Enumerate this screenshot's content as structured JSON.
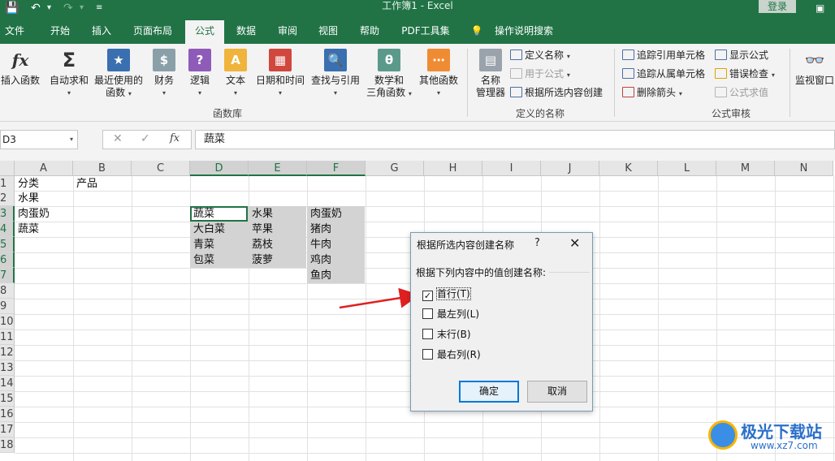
{
  "window": {
    "title": "工作簿1  -  Excel",
    "login_label": "登录"
  },
  "tabs": [
    {
      "label": "文件"
    },
    {
      "label": "开始"
    },
    {
      "label": "插入"
    },
    {
      "label": "页面布局"
    },
    {
      "label": "公式"
    },
    {
      "label": "数据"
    },
    {
      "label": "审阅"
    },
    {
      "label": "视图"
    },
    {
      "label": "帮助"
    },
    {
      "label": "PDF工具集"
    },
    {
      "label": "操作说明搜索"
    }
  ],
  "ribbon": {
    "buttons": [
      {
        "label": "插入函数"
      },
      {
        "label": "自动求和"
      },
      {
        "label": "最近使用的",
        "label2": "函数"
      },
      {
        "label": "财务"
      },
      {
        "label": "逻辑"
      },
      {
        "label": "文本"
      },
      {
        "label": "日期和时间"
      },
      {
        "label": "查找与引用"
      },
      {
        "label": "数学和",
        "label2": "三角函数"
      },
      {
        "label": "其他函数"
      },
      {
        "label": "名称",
        "label2": "管理器"
      },
      {
        "label": "监视窗口"
      }
    ],
    "names": {
      "define": "定义名称",
      "use": "用于公式",
      "create": "根据所选内容创建"
    },
    "audit": {
      "trace_prec": "追踪引用单元格",
      "trace_dep": "追踪从属单元格",
      "remove_arrows": "删除箭头",
      "show_formulas": "显示公式",
      "error_check": "错误检查",
      "eval_formula": "公式求值"
    },
    "groups": {
      "library": "函数库",
      "defined": "定义的名称",
      "auditing": "公式审核"
    }
  },
  "formula_bar": {
    "name_box": "D3",
    "content": "蔬菜",
    "fx": "fx"
  },
  "sheet": {
    "columns": [
      "A",
      "B",
      "C",
      "D",
      "E",
      "F",
      "G",
      "H",
      "I",
      "J",
      "K",
      "L",
      "M",
      "N"
    ],
    "rows": [
      "1",
      "2",
      "3",
      "4",
      "5",
      "6",
      "7",
      "8",
      "9",
      "10",
      "11",
      "12",
      "13",
      "14",
      "15",
      "16",
      "17",
      "18"
    ],
    "cells": {
      "A1": "分类",
      "B1": "产品",
      "A2": "水果",
      "A3": "肉蛋奶",
      "A4": "蔬菜",
      "D3": "蔬菜",
      "D4": "大白菜",
      "D5": "青菜",
      "D6": "包菜",
      "E3": "水果",
      "E4": "苹果",
      "E5": "荔枝",
      "E6": "菠萝",
      "F3": "肉蛋奶",
      "F4": "猪肉",
      "F5": "牛肉",
      "F6": "鸡肉",
      "F7": "鱼肉"
    }
  },
  "dialog": {
    "title": "根据所选内容创建名称",
    "help": "?",
    "prompt": "根据下列内容中的值创建名称:",
    "options": [
      {
        "label": "首行(T)",
        "checked": true
      },
      {
        "label": "最左列(L)",
        "checked": false
      },
      {
        "label": "末行(B)",
        "checked": false
      },
      {
        "label": "最右列(R)",
        "checked": false
      }
    ],
    "ok": "确定",
    "cancel": "取消"
  },
  "watermark": {
    "brand": "极光下载站",
    "url": "www.xz7.com"
  },
  "colors": {
    "excel_green": "#217346",
    "arrow_red": "#e02020"
  }
}
